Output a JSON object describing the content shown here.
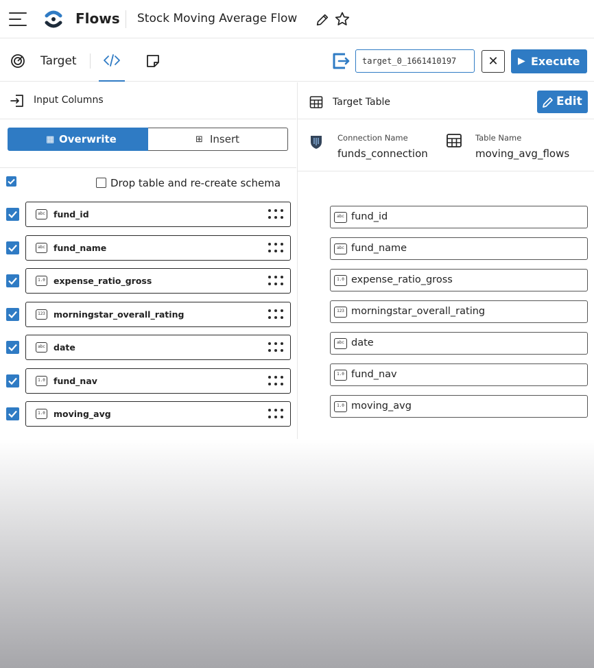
{
  "header": {
    "app_title": "Flows",
    "flow_title": "Stock Moving Average Flow"
  },
  "toolbar": {
    "target_label": "Target",
    "target_name_value": "target_0_1661410197",
    "execute_label": "Execute",
    "clear_symbol": "✕"
  },
  "left_panel": {
    "title": "Input Columns",
    "modes": [
      "Overwrite",
      "Insert"
    ],
    "active_mode": "Overwrite",
    "drop_table_label": "Drop table and re-create schema",
    "drop_table_checked": false,
    "select_all_checked": true,
    "columns": [
      {
        "name": "fund_id",
        "type": "abc",
        "checked": true
      },
      {
        "name": "fund_name",
        "type": "abc",
        "checked": true
      },
      {
        "name": "expense_ratio_gross",
        "type": "1.0",
        "checked": true
      },
      {
        "name": "morningstar_overall_rating",
        "type": "123",
        "checked": true
      },
      {
        "name": "date",
        "type": "abc",
        "checked": true
      },
      {
        "name": "fund_nav",
        "type": "1.0",
        "checked": true
      },
      {
        "name": "moving_avg",
        "type": "1.0",
        "checked": true
      }
    ]
  },
  "right_panel": {
    "title": "Target Table",
    "edit_label": "Edit",
    "connection_label": "Connection Name",
    "connection_value": "funds_connection",
    "table_name_label": "Table Name",
    "table_name_value": "moving_avg_flows",
    "columns": [
      {
        "name": "fund_id",
        "type": "abc"
      },
      {
        "name": "fund_name",
        "type": "abc"
      },
      {
        "name": "expense_ratio_gross",
        "type": "1.0"
      },
      {
        "name": "morningstar_overall_rating",
        "type": "123"
      },
      {
        "name": "date",
        "type": "abc"
      },
      {
        "name": "fund_nav",
        "type": "1.0"
      },
      {
        "name": "moving_avg",
        "type": "1.0"
      }
    ]
  },
  "colors": {
    "accent": "#2f7bc4"
  }
}
